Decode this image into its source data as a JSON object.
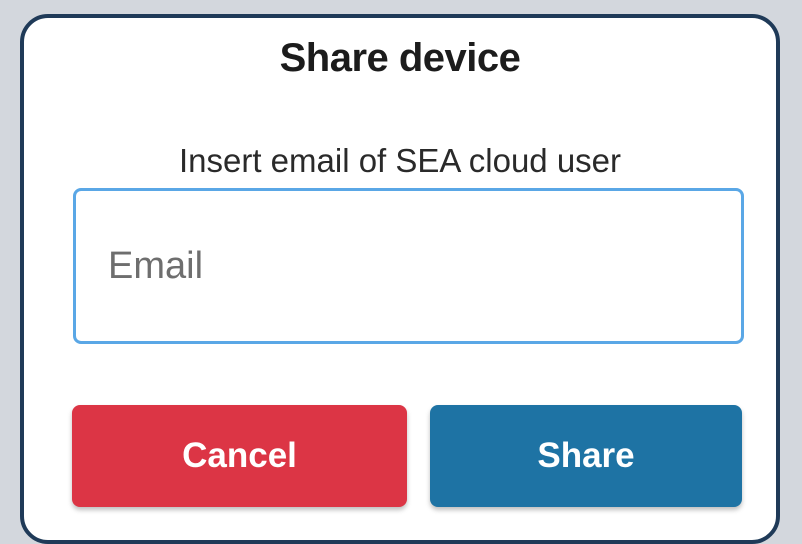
{
  "dialog": {
    "title": "Share device",
    "instruction": "Insert email of SEA cloud user",
    "email_field": {
      "placeholder": "Email",
      "value": ""
    },
    "cancel_label": "Cancel",
    "share_label": "Share"
  },
  "colors": {
    "dialog_border": "#1f3a58",
    "input_border": "#5aa7e6",
    "cancel_button": "#dc3545",
    "share_button": "#1e73a4"
  }
}
